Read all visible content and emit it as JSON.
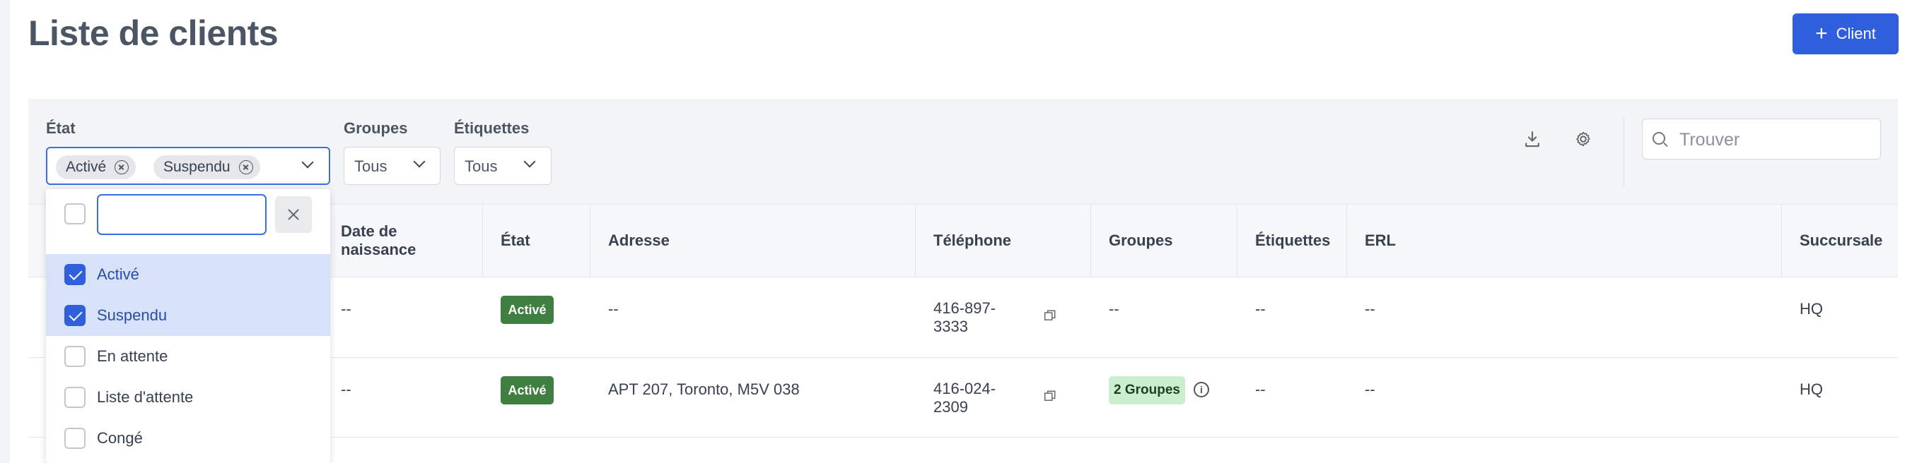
{
  "page": {
    "title": "Liste de clients"
  },
  "header": {
    "add_button_label": "Client"
  },
  "filters": {
    "state_label": "État",
    "state_chips": [
      "Activé",
      "Suspendu"
    ],
    "groups_label": "Groupes",
    "groups_value": "Tous",
    "tags_label": "Étiquettes",
    "tags_value": "Tous"
  },
  "toolbar": {
    "download_icon": "download-icon",
    "settings_icon": "gear-icon"
  },
  "search": {
    "placeholder": "Trouver"
  },
  "table": {
    "columns": [
      "Date de naissance",
      "État",
      "Adresse",
      "Téléphone",
      "Groupes",
      "Étiquettes",
      "ERL",
      "Succursale"
    ],
    "rows": [
      {
        "birth": "--",
        "state": "Activé",
        "address": "--",
        "phone": "416-897-3333",
        "groups": "--",
        "tags": "--",
        "erl": "--",
        "branch": "HQ"
      },
      {
        "birth": "--",
        "state": "Activé",
        "address": "APT 207, Toronto, M5V 038",
        "phone": "416-024-2309",
        "groups": "2 Groupes",
        "tags": "--",
        "erl": "--",
        "branch": "HQ"
      }
    ]
  },
  "state_dropdown": {
    "search_value": "",
    "options": [
      {
        "label": "Activé",
        "checked": true
      },
      {
        "label": "Suspendu",
        "checked": true
      },
      {
        "label": "En attente",
        "checked": false
      },
      {
        "label": "Liste d'attente",
        "checked": false
      },
      {
        "label": "Congé",
        "checked": false
      }
    ]
  },
  "colors": {
    "primary": "#2f5fdc",
    "active_badge": "#3f7f3f",
    "groups_badge": "#c9efcf",
    "selected_option_bg": "#d7e1f7"
  }
}
